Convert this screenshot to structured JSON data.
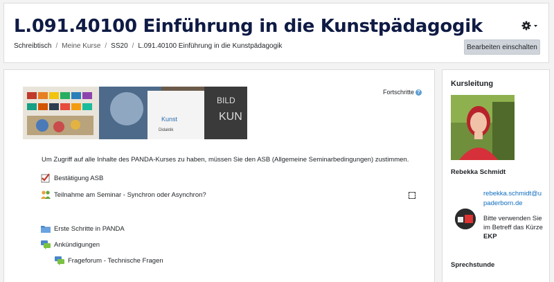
{
  "header": {
    "title": "L.091.40100 Einführung in die Kunstpädagogik",
    "breadcrumb": [
      "Schreibtisch",
      "Meine Kurse",
      "SS20",
      "L.091.40100 Einführung in die Kunstpädagogik"
    ],
    "edit_button": "Bearbeiten einschalten",
    "menu_icon": "gear-icon"
  },
  "main": {
    "banner_text": [
      "Kunst",
      "Didaktik",
      "BILD",
      "KUN"
    ],
    "progress_label": "Fortschritte",
    "intro": "Um Zugriff auf alle Inhalte des PANDA-Kurses zu haben, müssen Sie den ASB (Allgemeine Seminarbedingungen) zustimmen.",
    "activities": [
      {
        "label": "Bestätigung ASB",
        "icon": "checklist-icon"
      },
      {
        "label": "Teilnahme am Seminar - Synchron oder Asynchron?",
        "icon": "choice-people-icon"
      },
      {
        "label": "Erste Schritte in PANDA",
        "icon": "folder-icon"
      },
      {
        "label": "Ankündigungen",
        "icon": "forum-icon"
      },
      {
        "label": "Frageforum - Technische Fragen",
        "icon": "forum-icon"
      }
    ]
  },
  "sidebar": {
    "title": "Kursleitung",
    "name": "Rebekka Schmidt",
    "email_line1": "rebekka.schmidt@u",
    "email_line2": "paderborn.de",
    "note_line1": "Bitte verwenden Sie",
    "note_line2": "im Betreff das Kürze",
    "note_line3": "EKP",
    "subheading": "Sprechstunde"
  },
  "colors": {
    "title": "#0f1b44",
    "link": "#0f6cbf",
    "button_bg": "#ced4da"
  }
}
